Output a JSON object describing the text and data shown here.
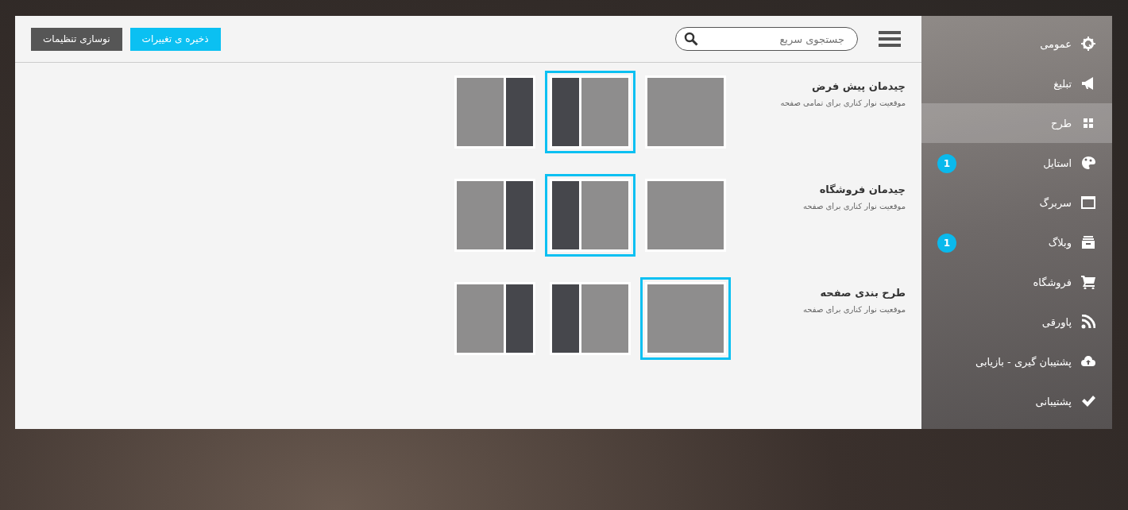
{
  "sidebar": {
    "items": [
      {
        "label": "عمومی",
        "kind": "gear",
        "selected": false
      },
      {
        "label": "تبلیغ",
        "kind": "megaphone",
        "selected": false
      },
      {
        "label": "طرح",
        "kind": "grid",
        "selected": true
      },
      {
        "label": "استایل",
        "kind": "palette",
        "selected": false,
        "badge": "1"
      },
      {
        "label": "سربرگ",
        "kind": "window",
        "selected": false
      },
      {
        "label": "وبلاگ",
        "kind": "archive",
        "selected": false,
        "badge": "1"
      },
      {
        "label": "فروشگاه",
        "kind": "cart",
        "selected": false
      },
      {
        "label": "پاورقی",
        "kind": "rss",
        "selected": false
      },
      {
        "label": "پشتیبان گیری - بازیابی",
        "kind": "cloud",
        "selected": false
      },
      {
        "label": "پشتیبانی",
        "kind": "check",
        "selected": false
      }
    ]
  },
  "toolbar": {
    "search": {
      "placeholder": "جستجوی سریع"
    },
    "buttons": [
      {
        "label": "ذخیره ی تغییرات",
        "kind": "primary"
      },
      {
        "label": "نوسازی تنظیمات",
        "kind": "secondary"
      }
    ]
  },
  "sections": [
    {
      "title": "چیدمان پیش فرض",
      "description": "موقعیت نوار کناری برای تمامی صفحه",
      "options": [
        {
          "kind": "full",
          "selected": false
        },
        {
          "kind": "sidebar-left",
          "selected": true
        },
        {
          "kind": "sidebar-right",
          "selected": false
        }
      ]
    },
    {
      "title": "چیدمان فروشگاه",
      "description": "موقعیت نوار کناری برای صفحه",
      "options": [
        {
          "kind": "full",
          "selected": false
        },
        {
          "kind": "sidebar-left",
          "selected": true
        },
        {
          "kind": "sidebar-right",
          "selected": false
        }
      ]
    },
    {
      "title": "طرح بندی صفحه",
      "description": "موقعیت نوار کناری برای صفحه",
      "options": [
        {
          "kind": "full",
          "selected": true
        },
        {
          "kind": "sidebar-left",
          "selected": false
        },
        {
          "kind": "sidebar-right",
          "selected": false
        }
      ]
    }
  ]
}
